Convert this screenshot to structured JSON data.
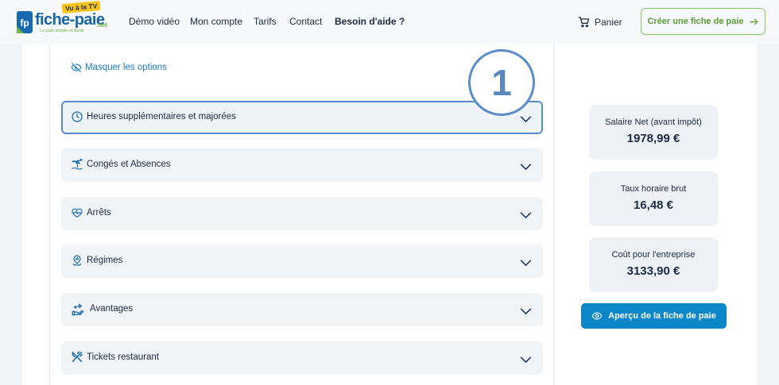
{
  "header": {
    "logo": {
      "mark": "fp",
      "name": "fiche-paie",
      "badge": "Vu à la TV",
      "suffix": ".net",
      "tagline": "La paie simple et facile"
    },
    "nav": [
      {
        "label": "Démo vidéo"
      },
      {
        "label": "Mon compte"
      },
      {
        "label": "Tarifs"
      },
      {
        "label": "Contact"
      },
      {
        "label": "Besoin d'aide ?"
      }
    ],
    "cart": {
      "label": "Panier",
      "icon": "cart-icon"
    },
    "cta": {
      "label": "Créer une fiche de paie",
      "icon": "arrow-right-icon"
    }
  },
  "options": {
    "toggle_label": "Masquer les options",
    "toggle_icon": "eye-slash-icon"
  },
  "sections": [
    {
      "label": "Heures supplémentaires et majorées",
      "icon": "clock-icon",
      "expanded": false,
      "focused": true
    },
    {
      "label": "Congés et Absences",
      "icon": "palm-tree-icon",
      "expanded": false,
      "focused": false
    },
    {
      "label": "Arrêts",
      "icon": "heart-pulse-icon",
      "expanded": false,
      "focused": false
    },
    {
      "label": "Régimes",
      "icon": "map-pin-icon",
      "expanded": false,
      "focused": false
    },
    {
      "label": "Avantages",
      "icon": "sparkle-hand-icon",
      "expanded": false,
      "focused": false
    },
    {
      "label": "Tickets restaurant",
      "icon": "fork-knife-icon",
      "expanded": false,
      "focused": false
    }
  ],
  "annotation": {
    "number": "1"
  },
  "summary": {
    "stats": [
      {
        "label": "Salaire Net (avant impôt)",
        "value": "1978,99 €"
      },
      {
        "label": "Taux horaire brut",
        "value": "16,48 €"
      },
      {
        "label": "Coût pour l'entreprise",
        "value": "3133,90 €"
      }
    ],
    "preview_button": {
      "label": "Aperçu de la fiche de paie",
      "icon": "eye-icon"
    }
  },
  "colors": {
    "accent": "#0b86c8",
    "brand_green": "#5b9b35",
    "focus_border": "#5a8ccb",
    "text": "#1c2a44",
    "annotation": "#5b87bf"
  }
}
